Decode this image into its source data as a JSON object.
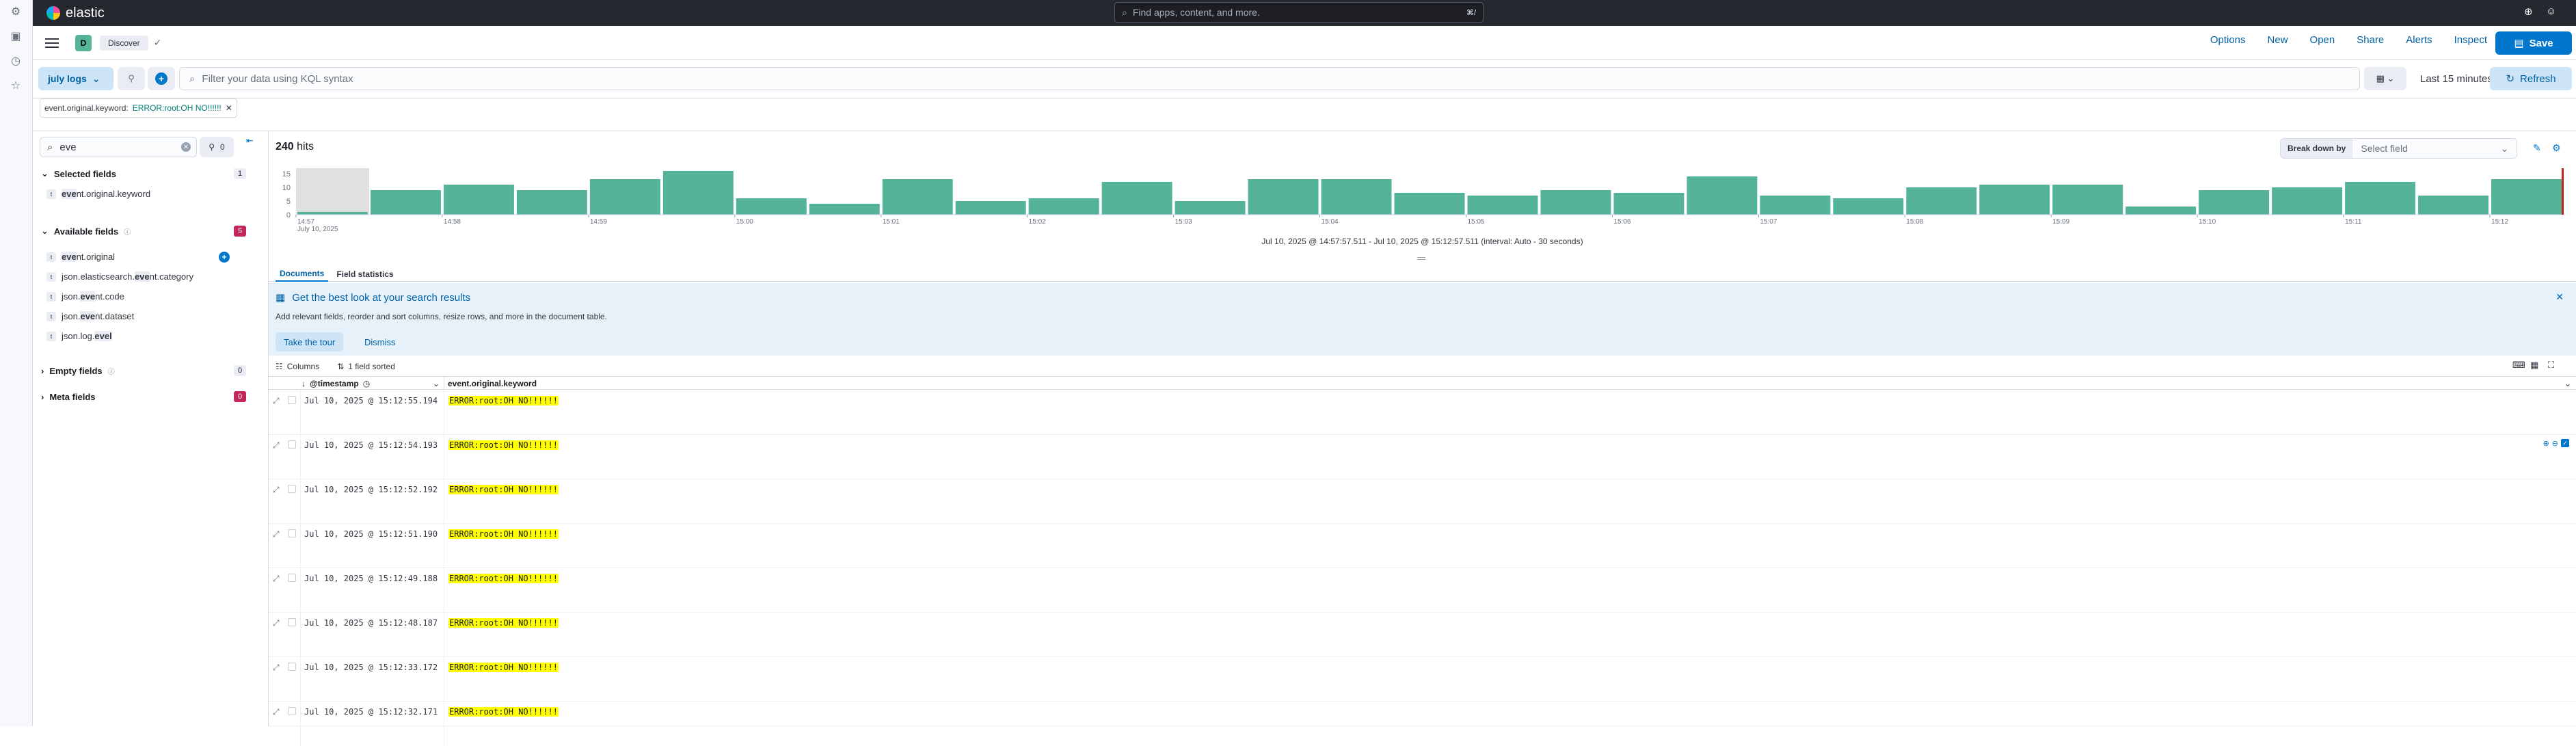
{
  "header": {
    "logo_text": "elastic",
    "search_placeholder": "Find apps, content, and more.",
    "search_shortcut": "⌘/"
  },
  "app_header": {
    "space_initial": "D",
    "breadcrumb": "Discover",
    "links": [
      "Options",
      "New",
      "Open",
      "Share",
      "Alerts",
      "Inspect"
    ],
    "save_label": "Save"
  },
  "query_bar": {
    "data_view": "july logs",
    "kql_placeholder": "Filter your data using KQL syntax",
    "date_range": "Last 15 minutes",
    "refresh_label": "Refresh"
  },
  "filter_pill": {
    "field": "event.original.keyword:",
    "value": "ERROR:root:OH NO!!!!!!"
  },
  "sidebar": {
    "search_value": "eve",
    "filter_count": "0",
    "selected": {
      "label": "Selected fields",
      "count": "1",
      "fields": [
        {
          "type": "t",
          "pre": "",
          "match": "eve",
          "post": "nt.original.keyword"
        }
      ]
    },
    "available": {
      "label": "Available fields",
      "count": "5",
      "fields": [
        {
          "type": "t",
          "pre": "",
          "match": "eve",
          "post": "nt.original"
        },
        {
          "type": "t",
          "pre": "json.elasticsearch.",
          "match": "eve",
          "post": "nt.category"
        },
        {
          "type": "t",
          "pre": "json.",
          "match": "eve",
          "post": "nt.code"
        },
        {
          "type": "t",
          "pre": "json.",
          "match": "eve",
          "post": "nt.dataset"
        },
        {
          "type": "t",
          "pre": "json.log.",
          "match": "evel",
          "post": ""
        }
      ]
    },
    "empty": {
      "label": "Empty fields",
      "count": "0"
    },
    "meta": {
      "label": "Meta fields",
      "count": "0"
    }
  },
  "main": {
    "hits_count": "240",
    "hits_label": "hits",
    "breakdown_label": "Break down by",
    "breakdown_placeholder": "Select field",
    "interval_text": "Jul 10, 2025 @ 14:57:57.511 - Jul 10, 2025 @ 15:12:57.511 (interval: Auto - 30 seconds)",
    "tabs": [
      "Documents",
      "Field statistics"
    ],
    "callout": {
      "title": "Get the best look at your search results",
      "description": "Add relevant fields, reorder and sort columns, resize rows, and more in the document table.",
      "tour_label": "Take the tour",
      "dismiss_label": "Dismiss"
    },
    "grid": {
      "columns_label": "Columns",
      "sorted_label": "1 field sorted",
      "col_timestamp": "@timestamp",
      "col_value": "event.original.keyword",
      "rows": [
        {
          "ts": "Jul 10, 2025 @ 15:12:55.194",
          "val": "ERROR:root:OH NO!!!!!!"
        },
        {
          "ts": "Jul 10, 2025 @ 15:12:54.193",
          "val": "ERROR:root:OH NO!!!!!!"
        },
        {
          "ts": "Jul 10, 2025 @ 15:12:52.192",
          "val": "ERROR:root:OH NO!!!!!!"
        },
        {
          "ts": "Jul 10, 2025 @ 15:12:51.190",
          "val": "ERROR:root:OH NO!!!!!!"
        },
        {
          "ts": "Jul 10, 2025 @ 15:12:49.188",
          "val": "ERROR:root:OH NO!!!!!!"
        },
        {
          "ts": "Jul 10, 2025 @ 15:12:48.187",
          "val": "ERROR:root:OH NO!!!!!!"
        },
        {
          "ts": "Jul 10, 2025 @ 15:12:33.172",
          "val": "ERROR:root:OH NO!!!!!!"
        },
        {
          "ts": "Jul 10, 2025 @ 15:12:32.171",
          "val": "ERROR:root:OH NO!!!!!!"
        }
      ]
    }
  },
  "chart_data": {
    "type": "bar",
    "ylim": [
      0,
      17
    ],
    "y_ticks": [
      "15",
      "10",
      "5",
      "0"
    ],
    "x_ticks": [
      "14:57",
      "14:58",
      "14:59",
      "15:00",
      "15:01",
      "15:02",
      "15:03",
      "15:04",
      "15:05",
      "15:06",
      "15:07",
      "15:08",
      "15:09",
      "15:10",
      "15:11",
      "15:12"
    ],
    "x_sub_label": "July 10, 2025",
    "bar_color": "#54b399",
    "values": [
      1,
      9,
      11,
      9,
      13,
      16,
      6,
      4,
      13,
      5,
      6,
      12,
      5,
      13,
      13,
      8,
      7,
      9,
      8,
      14,
      7,
      6,
      10,
      11,
      11,
      3,
      9,
      10,
      12,
      7,
      13
    ]
  },
  "icon_names": {
    "rail": [
      "gear-icon",
      "folder-icon",
      "clock-icon",
      "star-icon"
    ]
  }
}
